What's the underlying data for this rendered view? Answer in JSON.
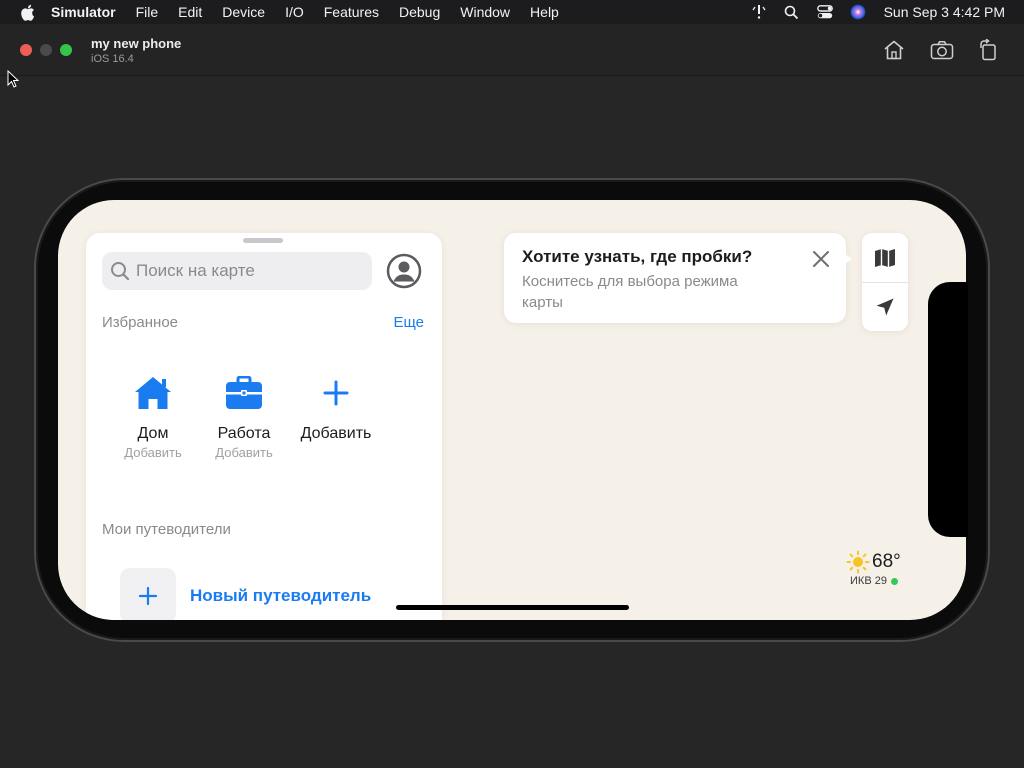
{
  "menubar": {
    "app_name": "Simulator",
    "items": [
      "File",
      "Edit",
      "Device",
      "I/O",
      "Features",
      "Debug",
      "Window",
      "Help"
    ],
    "clock": "Sun Sep 3  4:42 PM",
    "icons": [
      "apple-logo-icon",
      "alert-icon",
      "search-icon",
      "control-center-icon",
      "siri-icon"
    ]
  },
  "window": {
    "title": "my new phone",
    "subtitle": "iOS 16.4",
    "toolbar_icons": [
      "home-icon",
      "screenshot-icon",
      "rotate-icon"
    ]
  },
  "maps": {
    "search": {
      "placeholder": "Поиск на карте"
    },
    "favorites": {
      "title": "Избранное",
      "more": "Еще",
      "items": [
        {
          "name": "Дом",
          "sub": "Добавить",
          "icon": "house-icon"
        },
        {
          "name": "Работа",
          "sub": "Добавить",
          "icon": "briefcase-icon"
        },
        {
          "name": "Добавить",
          "sub": "",
          "icon": "plus-icon"
        }
      ]
    },
    "guides": {
      "title": "Мои путеводители",
      "new_guide": "Новый путеводитель"
    },
    "callout": {
      "title": "Хотите узнать, где пробки?",
      "text": "Коснитесь для выбора режима карты"
    },
    "weather": {
      "temp": "68°",
      "aqi": "ИКВ 29"
    },
    "colors": {
      "accent": "#1a7cf0",
      "map_background": "#f6f1e8",
      "aqi_good": "#34c759"
    }
  }
}
